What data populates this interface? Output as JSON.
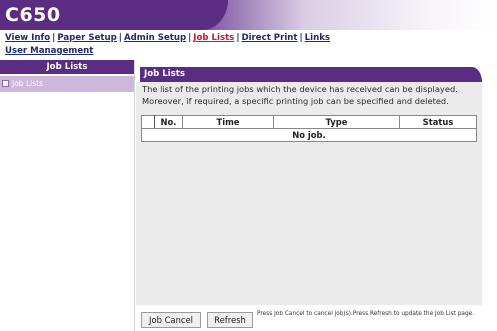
{
  "brand": {
    "title": "C650"
  },
  "nav": {
    "row1": [
      {
        "label": "View Info",
        "active": false
      },
      {
        "label": "Paper Setup",
        "active": false
      },
      {
        "label": "Admin Setup",
        "active": false
      },
      {
        "label": "Job Lists",
        "active": true
      },
      {
        "label": "Direct Print",
        "active": false
      },
      {
        "label": "Links",
        "active": false
      }
    ],
    "row2": [
      {
        "label": "User Management",
        "active": false
      }
    ]
  },
  "sidebar": {
    "heading": "Job Lists",
    "items": [
      {
        "label": "Job Lists"
      }
    ]
  },
  "main": {
    "title": "Job Lists",
    "description": "The list of the printing jobs which the device has received can be displayed. Moreover, if required, a specific printing job can be specified and deleted.",
    "table": {
      "columns": [
        "No.",
        "Time",
        "Type",
        "Status"
      ],
      "empty_message": "No job."
    }
  },
  "footer": {
    "cancel_label": "Job Cancel",
    "refresh_label": "Refresh",
    "hint": "Press Job Cancel to cancel job(s).Press Refresh to update the Job List page."
  },
  "colors": {
    "brand_purple": "#5b2d82",
    "sidebar_highlight": "#cdb8dc",
    "active_link": "#c0173b",
    "link": "#1f2a6e",
    "panel_bg": "#ebebeb"
  }
}
